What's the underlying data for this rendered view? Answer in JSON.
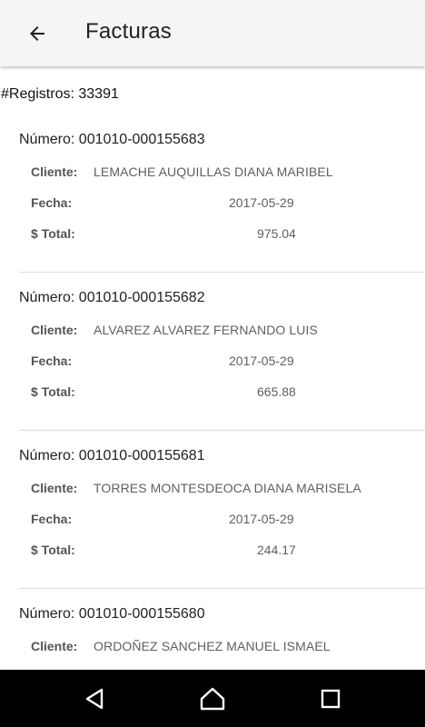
{
  "appbar": {
    "title": "Facturas",
    "back_icon": "arrow-back-icon"
  },
  "summary": {
    "record_count": "#Registros: 33391"
  },
  "labels": {
    "cliente": "Cliente:",
    "fecha": "Fecha:",
    "total": "$ Total:"
  },
  "invoices": [
    {
      "numero": "Número: 001010-000155683",
      "cliente": "LEMACHE AUQUILLAS DIANA MARIBEL",
      "fecha": "2017-05-29",
      "total": "975.04"
    },
    {
      "numero": "Número: 001010-000155682",
      "cliente": "ALVAREZ ALVAREZ FERNANDO LUIS",
      "fecha": "2017-05-29",
      "total": "665.88"
    },
    {
      "numero": "Número: 001010-000155681",
      "cliente": "TORRES MONTESDEOCA DIANA MARISELA",
      "fecha": "2017-05-29",
      "total": "244.17"
    },
    {
      "numero": "Número: 001010-000155680",
      "cliente": "ORDOÑEZ SANCHEZ MANUEL ISMAEL",
      "fecha": "",
      "total": ""
    }
  ],
  "navbar": {
    "back_icon": "nav-back-triangle-icon",
    "home_icon": "nav-home-icon",
    "recents_icon": "nav-recents-square-icon"
  },
  "colors": {
    "appbar_bg": "#f5f5f5",
    "navbar_bg": "#000000",
    "divider": "#dcdcdc",
    "label_text": "#555555",
    "value_text": "#5f5f5f"
  }
}
